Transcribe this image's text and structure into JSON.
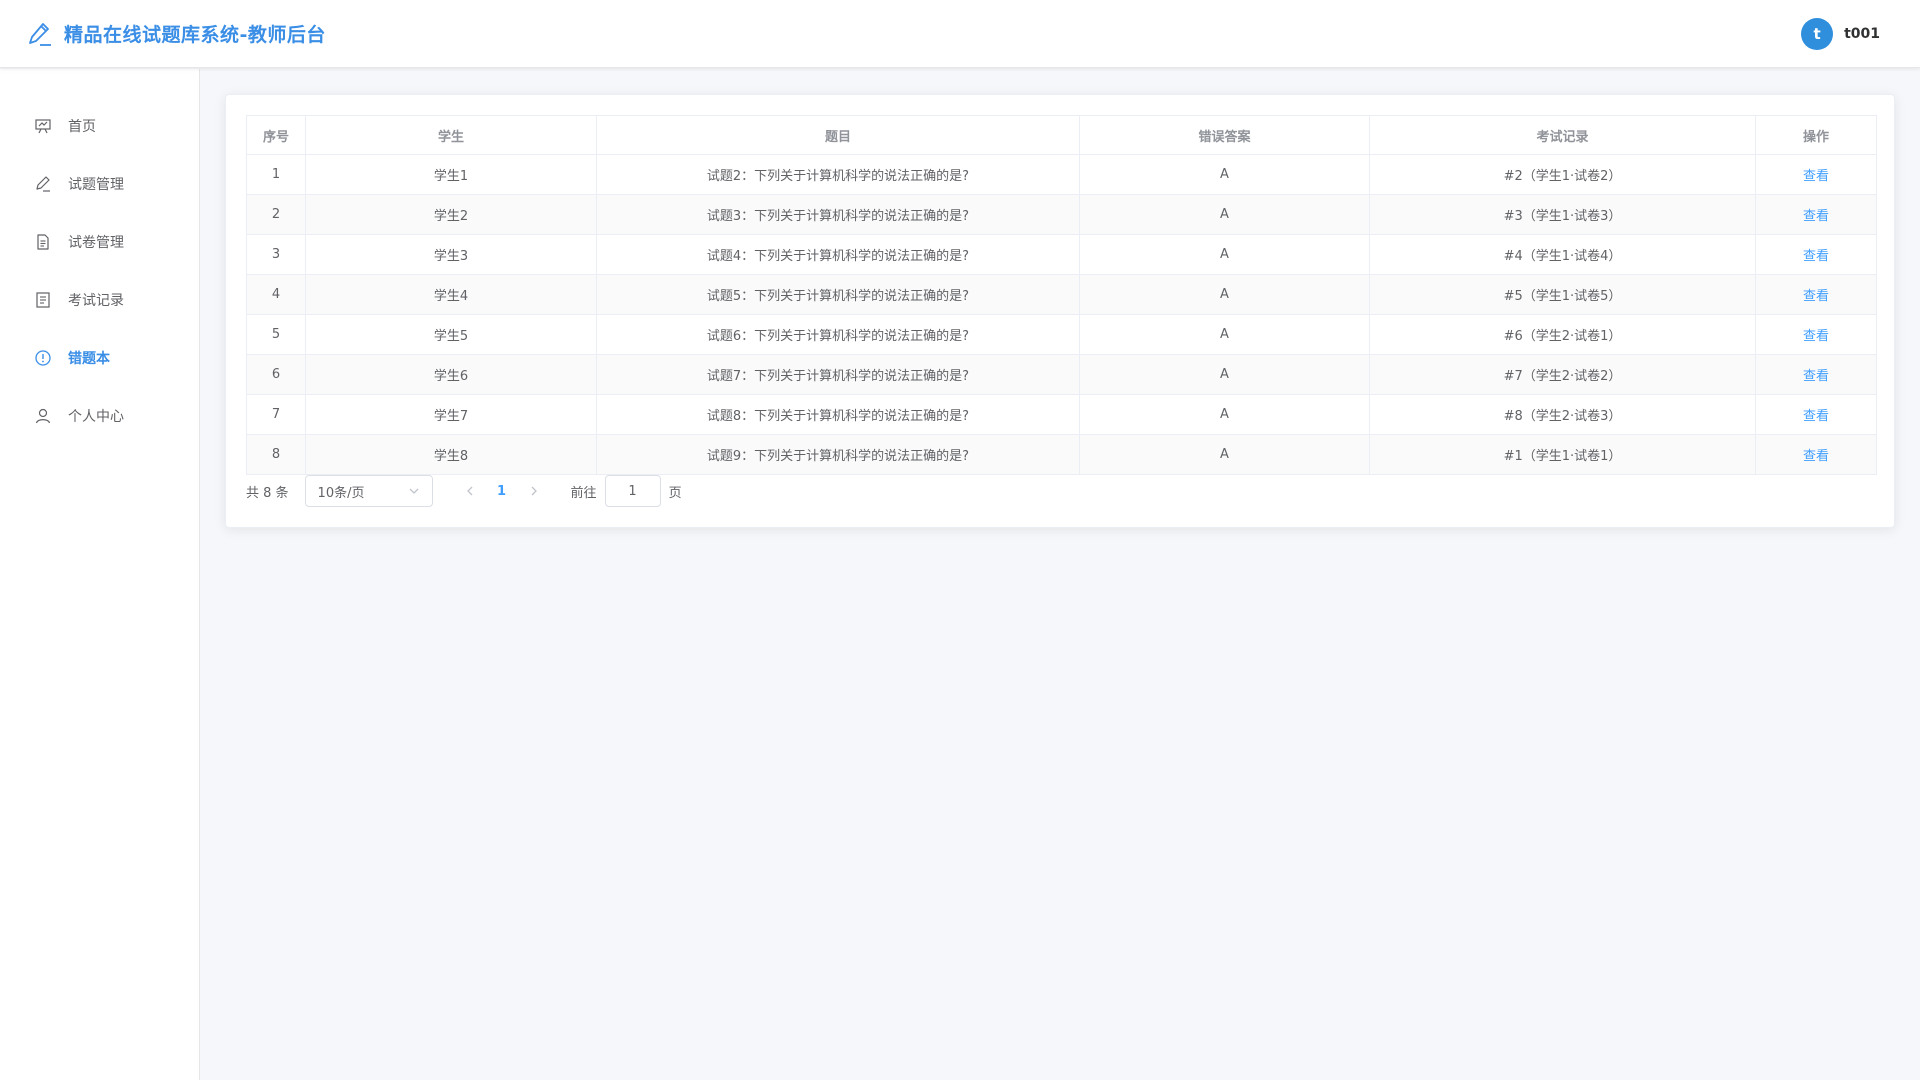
{
  "header": {
    "title": "精品在线试题库系统-教师后台",
    "avatar_letter": "t",
    "username": "t001"
  },
  "sidebar": {
    "items": [
      {
        "label": "首页",
        "icon": "presentation-icon"
      },
      {
        "label": "试题管理",
        "icon": "pen-icon"
      },
      {
        "label": "试卷管理",
        "icon": "document-icon"
      },
      {
        "label": "考试记录",
        "icon": "list-icon"
      },
      {
        "label": "错题本",
        "icon": "info-circle-icon",
        "active": true
      },
      {
        "label": "个人中心",
        "icon": "user-icon"
      }
    ]
  },
  "table": {
    "columns": [
      "序号",
      "学生",
      "题目",
      "错误答案",
      "考试记录",
      "操作"
    ],
    "rows": [
      [
        "1",
        "学生1",
        "试题2：下列关于计算机科学的说法正确的是?",
        "A",
        "#2（学生1·试卷2）",
        "查看"
      ],
      [
        "2",
        "学生2",
        "试题3：下列关于计算机科学的说法正确的是?",
        "A",
        "#3（学生1·试卷3）",
        "查看"
      ],
      [
        "3",
        "学生3",
        "试题4：下列关于计算机科学的说法正确的是?",
        "A",
        "#4（学生1·试卷4）",
        "查看"
      ],
      [
        "4",
        "学生4",
        "试题5：下列关于计算机科学的说法正确的是?",
        "A",
        "#5（学生1·试卷5）",
        "查看"
      ],
      [
        "5",
        "学生5",
        "试题6：下列关于计算机科学的说法正确的是?",
        "A",
        "#6（学生2·试卷1）",
        "查看"
      ],
      [
        "6",
        "学生6",
        "试题7：下列关于计算机科学的说法正确的是?",
        "A",
        "#7（学生2·试卷2）",
        "查看"
      ],
      [
        "7",
        "学生7",
        "试题8：下列关于计算机科学的说法正确的是?",
        "A",
        "#8（学生2·试卷3）",
        "查看"
      ],
      [
        "8",
        "学生8",
        "试题9：下列关于计算机科学的说法正确的是?",
        "A",
        "#1（学生1·试卷1）",
        "查看"
      ]
    ]
  },
  "pagination": {
    "total_text": "共 8 条",
    "page_size": "10条/页",
    "current_page": "1",
    "jump_prefix": "前往",
    "jump_value": "1",
    "jump_suffix": "页"
  },
  "colors": {
    "accent": "#409eff",
    "brand": "#3a8ee6",
    "avatar_bg": "#2f8fdd"
  }
}
